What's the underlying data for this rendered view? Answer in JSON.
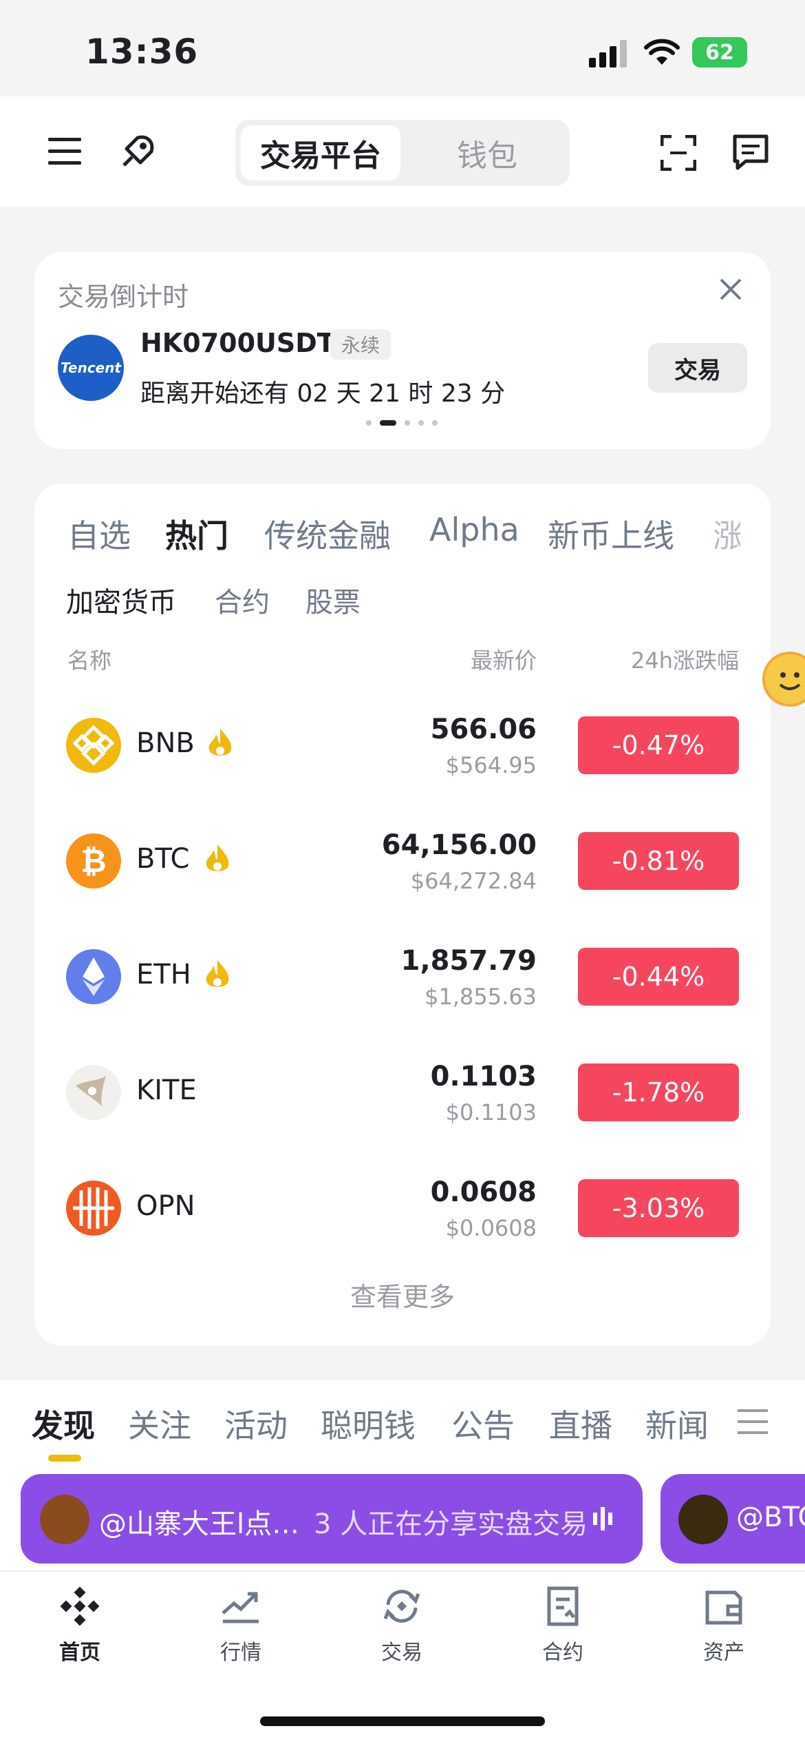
{
  "status_bar": {
    "time": "13:36",
    "battery": "62"
  },
  "header": {
    "tab_exchange": "交易平台",
    "tab_wallet": "钱包",
    "scan_icon": "scan-icon",
    "message_icon": "message-icon",
    "left_icon": "menu-icon"
  },
  "countdown_card": {
    "title": "交易倒计时",
    "logo_text": "Tencent",
    "symbol": "HK0700USDT",
    "tag": "永续",
    "countdown_text": "距离开始还有 02 天 21 时 23 分",
    "button": "交易"
  },
  "markets": {
    "tabs": [
      "自选",
      "热门",
      "传统金融",
      "Alpha",
      "新币上线",
      "涨"
    ],
    "active_tab": "热门",
    "subtabs": [
      "加密货币",
      "合约",
      "股票"
    ],
    "columns": {
      "name": "名称",
      "price": "最新价",
      "change": "24h涨跌幅"
    },
    "rows": [
      {
        "symbol": "BNB",
        "price": "566.06",
        "usd": "$564.95",
        "change": "-0.47%",
        "hot": true,
        "color": "#f0b90b"
      },
      {
        "symbol": "BTC",
        "price": "64,156.00",
        "usd": "$64,272.84",
        "change": "-0.81%",
        "hot": true,
        "color": "#f7931a"
      },
      {
        "symbol": "ETH",
        "price": "1,857.79",
        "usd": "$1,855.63",
        "change": "-0.44%",
        "hot": true,
        "color": "#627eea"
      },
      {
        "symbol": "KITE",
        "price": "0.1103",
        "usd": "$0.1103",
        "change": "-1.78%",
        "hot": false,
        "color": "#d8cfc4"
      },
      {
        "symbol": "OPN",
        "price": "0.0608",
        "usd": "$0.0608",
        "change": "-3.03%",
        "hot": false,
        "color": "#f05a22"
      }
    ],
    "more": "查看更多"
  },
  "discover": {
    "tabs": [
      "发现",
      "关注",
      "活动",
      "聪明钱",
      "公告",
      "直播",
      "新闻"
    ],
    "live_banner": {
      "user": "@山寨大王l点…",
      "text": "3 人正在分享实盘交易"
    },
    "live_banner_2": {
      "user": "@BTC"
    }
  },
  "bottom_nav": [
    "首页",
    "行情",
    "交易",
    "合约",
    "资产"
  ],
  "colors": {
    "accent": "#f0b90b",
    "down": "#f6465d",
    "live": "#8c4de6"
  }
}
